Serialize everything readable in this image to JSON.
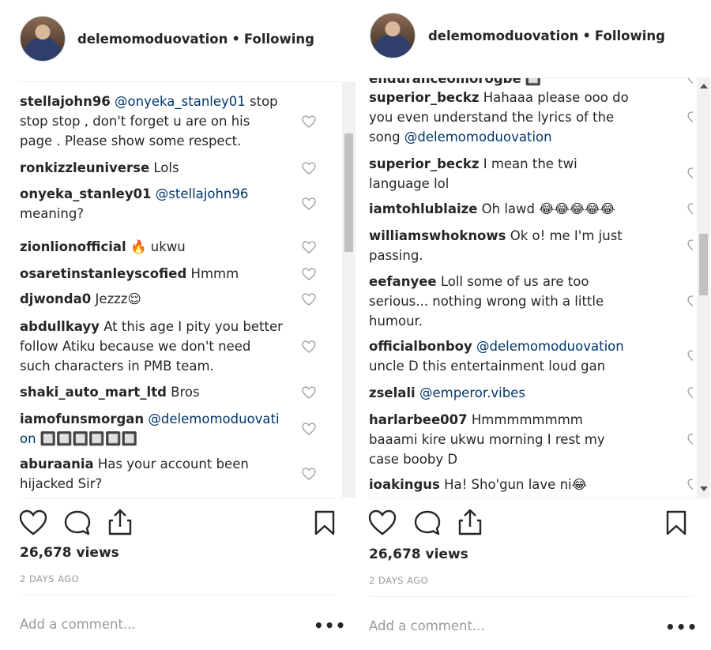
{
  "left": {
    "header": {
      "username": "delemomoduovation",
      "separator": "•",
      "follow_state": "Following"
    },
    "comments": [
      {
        "user": "stellajohn96",
        "parts": [
          {
            "t": "mention",
            "v": "@onyeka_stanley01"
          },
          {
            "t": "text",
            "v": " stop"
          }
        ],
        "lines": [
          "stop stop , don't forget u are on his",
          "page . Please show some respect."
        ]
      },
      {
        "user": "ronkizzleuniverse",
        "parts": [
          {
            "t": "text",
            "v": "Lols"
          }
        ],
        "lines": []
      },
      {
        "user": "onyeka_stanley01",
        "parts": [
          {
            "t": "mention",
            "v": "@stellajohn96"
          }
        ],
        "lines": [
          "meaning?"
        ]
      },
      {
        "user": "zionlionofficial",
        "parts": [
          {
            "t": "text",
            "v": "🔥 ukwu"
          }
        ],
        "lines": []
      },
      {
        "user": "osaretinstanleyscofied",
        "parts": [
          {
            "t": "text",
            "v": "Hmmm"
          }
        ],
        "lines": []
      },
      {
        "user": "djwonda0",
        "parts": [
          {
            "t": "text",
            "v": "Jezzz😌"
          }
        ],
        "lines": []
      },
      {
        "user": "abdullkayy",
        "parts": [
          {
            "t": "text",
            "v": "At this age I pity you better"
          }
        ],
        "lines": [
          "follow Atiku because we don't need",
          "such characters in PMB team."
        ]
      },
      {
        "user": "shaki_auto_mart_ltd",
        "parts": [
          {
            "t": "text",
            "v": "Bros"
          }
        ],
        "lines": []
      },
      {
        "user": "iamofunsmorgan",
        "parts": [
          {
            "t": "mention",
            "v": "@delemomoduovati"
          }
        ],
        "lines_mention": [
          "on 🔲🔲🔲🔲🔲🔲"
        ]
      },
      {
        "user": "aburaania",
        "parts": [
          {
            "t": "text",
            "v": "Has your account been"
          }
        ],
        "lines": [
          "hijacked Sir?"
        ]
      }
    ],
    "views": "26,678 views",
    "date": "2 DAYS AGO",
    "add_comment_placeholder": "Add a comment...",
    "more_label": "•••"
  },
  "right": {
    "header": {
      "username": "delemomoduovation",
      "separator": "•",
      "follow_state": "Following"
    },
    "comments": [
      {
        "user": "enduranceomorogbe",
        "parts": [
          {
            "t": "text",
            "v": "🔲"
          }
        ],
        "lines": []
      },
      {
        "user": "superior_beckz",
        "parts": [
          {
            "t": "text",
            "v": "Hahaaa please ooo do"
          }
        ],
        "lines": [
          "you even understand the lyrics of the"
        ],
        "tail_line": [
          {
            "t": "text",
            "v": "song "
          },
          {
            "t": "mention",
            "v": "@delemomoduovation"
          }
        ]
      },
      {
        "user": "superior_beckz",
        "parts": [
          {
            "t": "text",
            "v": "I mean the twi"
          }
        ],
        "lines": [
          "language lol"
        ]
      },
      {
        "user": "iamtohlublaize",
        "parts": [
          {
            "t": "text",
            "v": "Oh lawd 😂😂😂😂😂"
          }
        ],
        "lines": []
      },
      {
        "user": "williamswhoknows",
        "parts": [
          {
            "t": "text",
            "v": "Ok o! me I'm just"
          }
        ],
        "lines": [
          "passing."
        ]
      },
      {
        "user": "eefanyee",
        "parts": [
          {
            "t": "text",
            "v": "Loll some of us are too"
          }
        ],
        "lines": [
          "serious... nothing wrong with a little",
          "humour."
        ]
      },
      {
        "user": "officialbonboy",
        "parts": [
          {
            "t": "mention",
            "v": "@delemomoduovation"
          }
        ],
        "lines": [
          "uncle D this entertainment loud gan"
        ]
      },
      {
        "user": "zselali",
        "parts": [
          {
            "t": "mention",
            "v": "@emperor.vibes"
          }
        ],
        "lines": []
      },
      {
        "user": "harlarbee007",
        "parts": [
          {
            "t": "text",
            "v": "Hmmmmmmmm"
          }
        ],
        "lines": [
          "baaami kire ukwu morning I rest my",
          "case booby D"
        ]
      },
      {
        "user": "ioakingus",
        "parts": [
          {
            "t": "text",
            "v": "Ha! Sho'gun lave ni😂"
          }
        ],
        "lines": []
      }
    ],
    "views": "26,678 views",
    "date": "2 DAYS AGO",
    "add_comment_placeholder": "Add a comment...",
    "more_label": "•••"
  },
  "colors": {
    "text": "#262626",
    "mention": "#003569",
    "muted": "#999999",
    "divider": "#efefef"
  },
  "icons": [
    "heart-icon",
    "comment-icon",
    "share-icon",
    "bookmark-icon",
    "small-heart-icon",
    "more-icon"
  ]
}
